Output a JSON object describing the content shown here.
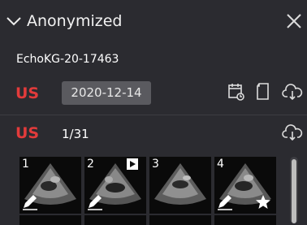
{
  "header": {
    "title": "Anonymized"
  },
  "study": {
    "id": "EchoKG-20-17463",
    "modality": "US",
    "date": "2020-12-14"
  },
  "series": {
    "modality": "US",
    "count": "1/31"
  },
  "thumbnails": [
    {
      "number": "1",
      "annotated": true,
      "cine": false,
      "starred": false
    },
    {
      "number": "2",
      "annotated": true,
      "cine": true,
      "starred": false
    },
    {
      "number": "3",
      "annotated": false,
      "cine": false,
      "starred": false
    },
    {
      "number": "4",
      "annotated": true,
      "cine": false,
      "starred": true
    }
  ],
  "colors": {
    "background": "#2b2b30",
    "modality_red": "#e23b3b",
    "date_badge": "#5a5a5f"
  },
  "icons": [
    "chevron-down-icon",
    "close-icon",
    "calendar-refresh-icon",
    "document-icon",
    "cloud-download-icon",
    "pen-icon",
    "play-icon",
    "star-icon"
  ]
}
